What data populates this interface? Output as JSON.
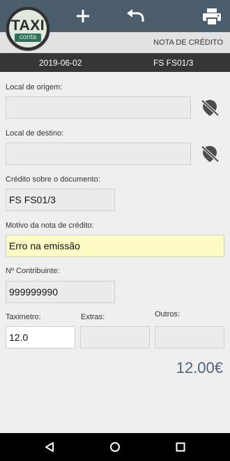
{
  "header": {
    "logo_main": "TAXI",
    "logo_sub": "conta",
    "actions": {
      "add_icon": "plus-icon",
      "undo_icon": "undo-icon",
      "print_icon": "printer-icon"
    },
    "screen_title": "NOTA DE CRÉDITO"
  },
  "docbar": {
    "date": "2019-06-02",
    "doc_ref": "FS FS01/3"
  },
  "form": {
    "origin_label": "Local de origem:",
    "origin_value": "",
    "destination_label": "Local de destino:",
    "destination_value": "",
    "credit_doc_label": "Crédito sobre o documento:",
    "credit_doc_value": "FS FS01/3",
    "reason_label": "Motivo da nota de crédito:",
    "reason_value": "Erro na emissão",
    "nif_label": "Nº Contribuinte:",
    "nif_value": "999999990",
    "taximeter_label": "Taximetro:",
    "taximeter_value": "12.0",
    "extras_label": "Extras:",
    "extras_value": "",
    "others_label": "Outros:",
    "others_value": ""
  },
  "total": "12.00€",
  "colors": {
    "topbar": "#4a5d6c",
    "accent_total": "#4e6479",
    "reason_bg": "#fbfbc3"
  }
}
